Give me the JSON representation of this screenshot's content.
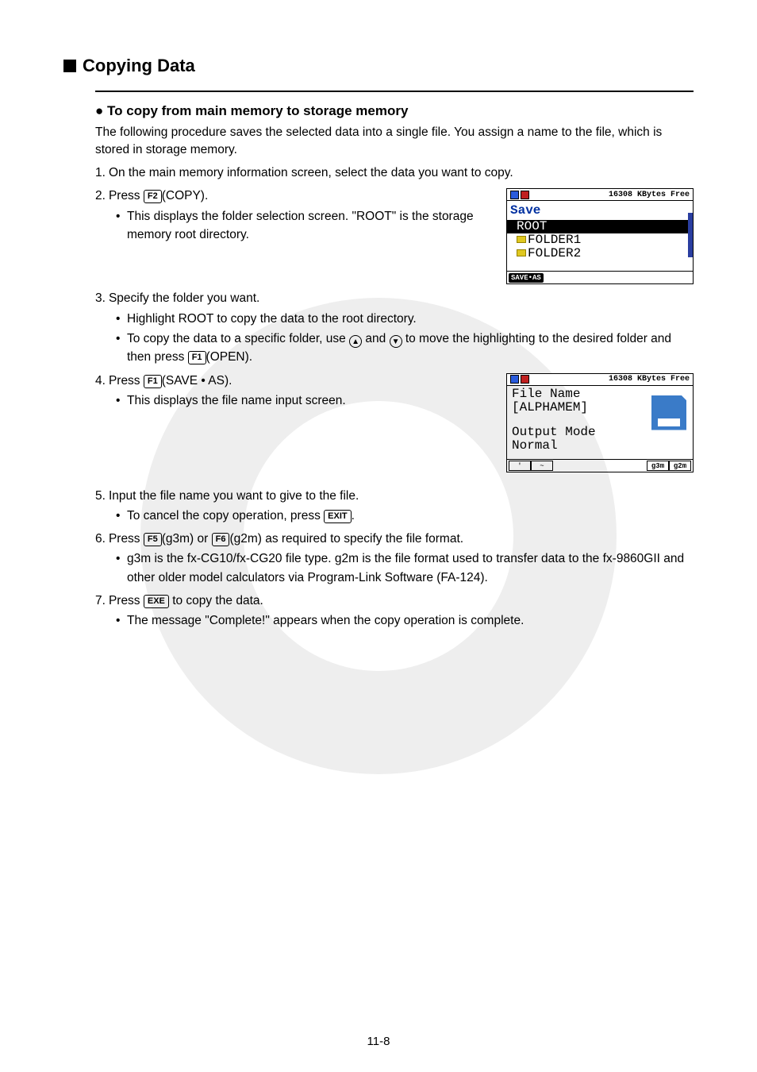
{
  "heading": "Copying Data",
  "subheading_prefix": "●",
  "subheading": "To copy from main memory to storage memory",
  "intro": "The following procedure saves the selected data into a single file. You assign a name to the file, which is stored in storage memory.",
  "steps": {
    "s1": {
      "num": "1.",
      "text": " On the main memory information screen, select the data you want to copy."
    },
    "s2": {
      "num": "2.",
      "pre": " Press ",
      "key": "F2",
      "post": "(COPY).",
      "sub": "This displays the folder selection screen. \"ROOT\" is the storage memory root directory."
    },
    "s3": {
      "num": "3.",
      "text": " Specify the folder you want.",
      "sub1": "Highlight ROOT to copy the data to the root directory.",
      "sub2_pre": "To copy the data to a specific folder, use ",
      "sub2_mid": " and ",
      "sub2_post": " to move the highlighting to the desired folder and then press ",
      "sub2_key": "F1",
      "sub2_end": "(OPEN)."
    },
    "s4": {
      "num": "4.",
      "pre": " Press ",
      "key": "F1",
      "post": "(SAVE • AS).",
      "sub": "This displays the file name input screen."
    },
    "s5": {
      "num": "5.",
      "text": " Input the file name you want to give to the file.",
      "sub_pre": "To cancel the copy operation, press ",
      "sub_key": "EXIT",
      "sub_post": "."
    },
    "s6": {
      "num": "6.",
      "pre": " Press ",
      "key1": "F5",
      "mid1": "(g3m) or ",
      "key2": "F6",
      "post": "(g2m) as required to specify the file format.",
      "sub": "g3m is the fx-CG10/fx-CG20 file type. g2m is the file format used to transfer data to the fx-9860GII and other older model calculators via Program-Link Software (FA-124)."
    },
    "s7": {
      "num": "7.",
      "pre": " Press ",
      "key": "EXE",
      "post": " to copy the data.",
      "sub": "The message \"Complete!\" appears when the copy operation is complete."
    }
  },
  "screen1": {
    "status": "16308 KBytes Free",
    "title": "Save",
    "root": "ROOT",
    "folder1": "FOLDER1",
    "folder2": "FOLDER2",
    "fkey": "SAVE•AS"
  },
  "screen2": {
    "status": "16308 KBytes Free",
    "l1": "File Name",
    "l2": "[ALPHAMEM]",
    "l3": "Output Mode",
    "l4": "Normal",
    "fk1": "'",
    "fk2": "~",
    "fk5": "g3m",
    "fk6": "g2m"
  },
  "pagenum": "11-8"
}
